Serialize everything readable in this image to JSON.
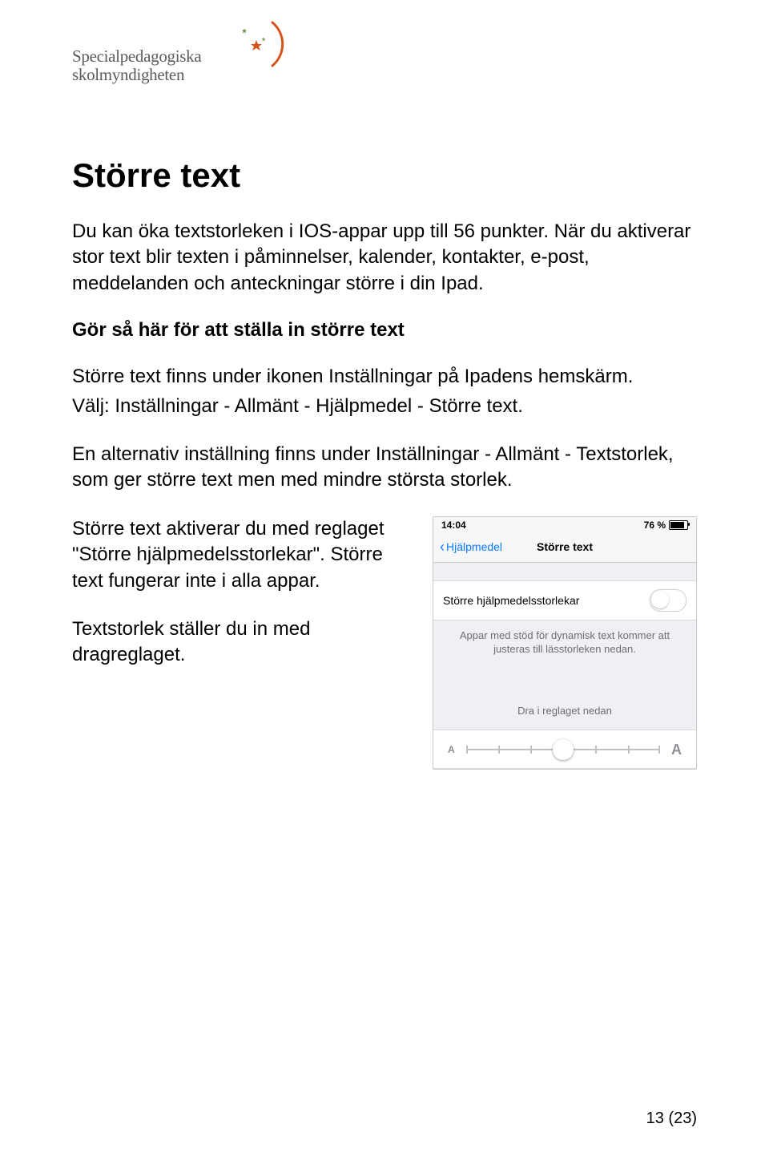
{
  "logo": {
    "line1": "Specialpedagogiska",
    "line2": "skolmyndigheten"
  },
  "heading": "Större text",
  "para1": "Du kan öka textstorleken i IOS-appar upp till 56 punkter. När du aktiverar stor text blir texten i påminnelser, kalender, kontakter, e-post, meddelanden och anteckningar större i din Ipad.",
  "sub": "Gör så här för att ställa in större text",
  "para2": "Större text finns under ikonen Inställningar på Ipadens hemskärm.",
  "para3": "Välj: Inställningar - Allmänt - Hjälpmedel - Större text.",
  "para4": "En alternativ inställning finns under Inställningar - Allmänt - Textstorlek, som ger större text men med mindre största storlek.",
  "para5": "Större text aktiverar du med reglaget \"Större hjälpmedelsstorlekar\". Större text fungerar inte i alla appar.",
  "para6": "Textstorlek ställer du in med dragreglaget.",
  "screenshot": {
    "time": "14:04",
    "battery": "76 %",
    "back_label": "Hjälpmedel",
    "title": "Större text",
    "row_label": "Större hjälpmedelsstorlekar",
    "caption": "Appar med stöd för dynamisk text kommer att justeras till lässtorleken nedan.",
    "slider_hint": "Dra i reglaget nedan",
    "a_small": "A",
    "a_big": "A"
  },
  "page_num": "13 (23)"
}
